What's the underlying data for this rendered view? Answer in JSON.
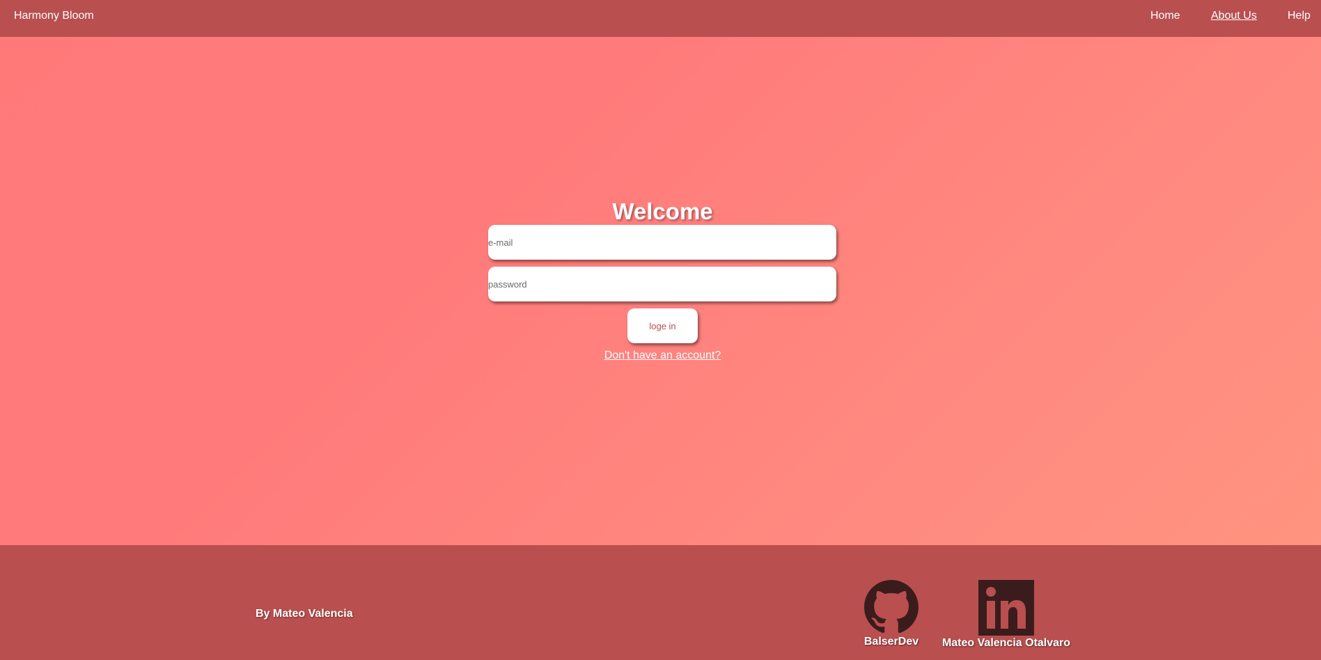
{
  "nav": {
    "brand": "Harmony Bloom",
    "links": [
      {
        "label": "Home"
      },
      {
        "label": "About Us"
      },
      {
        "label": "Help"
      }
    ]
  },
  "login": {
    "title": "Welcome",
    "email_placeholder": "e-mail",
    "password_placeholder": "password",
    "submit_label": "loge in",
    "signup_link": "Don't have an account?"
  },
  "footer": {
    "byline": "By Mateo Valencia",
    "social": [
      {
        "icon": "github-icon",
        "label": "BalserDev"
      },
      {
        "icon": "linkedin-icon",
        "label": "Mateo Valencia Otalvaro"
      }
    ]
  },
  "colors": {
    "bar": "#b94f4f",
    "background": "#ff7b7b",
    "icon": "#3b1c1c"
  }
}
